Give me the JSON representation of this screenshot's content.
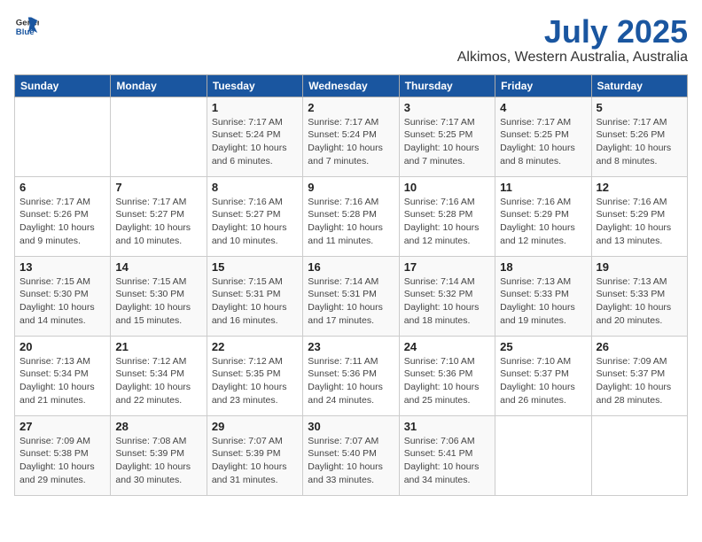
{
  "header": {
    "logo_general": "General",
    "logo_blue": "Blue",
    "title": "July 2025",
    "subtitle": "Alkimos, Western Australia, Australia"
  },
  "weekdays": [
    "Sunday",
    "Monday",
    "Tuesday",
    "Wednesday",
    "Thursday",
    "Friday",
    "Saturday"
  ],
  "weeks": [
    [
      {
        "day": "",
        "detail": ""
      },
      {
        "day": "",
        "detail": ""
      },
      {
        "day": "1",
        "detail": "Sunrise: 7:17 AM\nSunset: 5:24 PM\nDaylight: 10 hours\nand 6 minutes."
      },
      {
        "day": "2",
        "detail": "Sunrise: 7:17 AM\nSunset: 5:24 PM\nDaylight: 10 hours\nand 7 minutes."
      },
      {
        "day": "3",
        "detail": "Sunrise: 7:17 AM\nSunset: 5:25 PM\nDaylight: 10 hours\nand 7 minutes."
      },
      {
        "day": "4",
        "detail": "Sunrise: 7:17 AM\nSunset: 5:25 PM\nDaylight: 10 hours\nand 8 minutes."
      },
      {
        "day": "5",
        "detail": "Sunrise: 7:17 AM\nSunset: 5:26 PM\nDaylight: 10 hours\nand 8 minutes."
      }
    ],
    [
      {
        "day": "6",
        "detail": "Sunrise: 7:17 AM\nSunset: 5:26 PM\nDaylight: 10 hours\nand 9 minutes."
      },
      {
        "day": "7",
        "detail": "Sunrise: 7:17 AM\nSunset: 5:27 PM\nDaylight: 10 hours\nand 10 minutes."
      },
      {
        "day": "8",
        "detail": "Sunrise: 7:16 AM\nSunset: 5:27 PM\nDaylight: 10 hours\nand 10 minutes."
      },
      {
        "day": "9",
        "detail": "Sunrise: 7:16 AM\nSunset: 5:28 PM\nDaylight: 10 hours\nand 11 minutes."
      },
      {
        "day": "10",
        "detail": "Sunrise: 7:16 AM\nSunset: 5:28 PM\nDaylight: 10 hours\nand 12 minutes."
      },
      {
        "day": "11",
        "detail": "Sunrise: 7:16 AM\nSunset: 5:29 PM\nDaylight: 10 hours\nand 12 minutes."
      },
      {
        "day": "12",
        "detail": "Sunrise: 7:16 AM\nSunset: 5:29 PM\nDaylight: 10 hours\nand 13 minutes."
      }
    ],
    [
      {
        "day": "13",
        "detail": "Sunrise: 7:15 AM\nSunset: 5:30 PM\nDaylight: 10 hours\nand 14 minutes."
      },
      {
        "day": "14",
        "detail": "Sunrise: 7:15 AM\nSunset: 5:30 PM\nDaylight: 10 hours\nand 15 minutes."
      },
      {
        "day": "15",
        "detail": "Sunrise: 7:15 AM\nSunset: 5:31 PM\nDaylight: 10 hours\nand 16 minutes."
      },
      {
        "day": "16",
        "detail": "Sunrise: 7:14 AM\nSunset: 5:31 PM\nDaylight: 10 hours\nand 17 minutes."
      },
      {
        "day": "17",
        "detail": "Sunrise: 7:14 AM\nSunset: 5:32 PM\nDaylight: 10 hours\nand 18 minutes."
      },
      {
        "day": "18",
        "detail": "Sunrise: 7:13 AM\nSunset: 5:33 PM\nDaylight: 10 hours\nand 19 minutes."
      },
      {
        "day": "19",
        "detail": "Sunrise: 7:13 AM\nSunset: 5:33 PM\nDaylight: 10 hours\nand 20 minutes."
      }
    ],
    [
      {
        "day": "20",
        "detail": "Sunrise: 7:13 AM\nSunset: 5:34 PM\nDaylight: 10 hours\nand 21 minutes."
      },
      {
        "day": "21",
        "detail": "Sunrise: 7:12 AM\nSunset: 5:34 PM\nDaylight: 10 hours\nand 22 minutes."
      },
      {
        "day": "22",
        "detail": "Sunrise: 7:12 AM\nSunset: 5:35 PM\nDaylight: 10 hours\nand 23 minutes."
      },
      {
        "day": "23",
        "detail": "Sunrise: 7:11 AM\nSunset: 5:36 PM\nDaylight: 10 hours\nand 24 minutes."
      },
      {
        "day": "24",
        "detail": "Sunrise: 7:10 AM\nSunset: 5:36 PM\nDaylight: 10 hours\nand 25 minutes."
      },
      {
        "day": "25",
        "detail": "Sunrise: 7:10 AM\nSunset: 5:37 PM\nDaylight: 10 hours\nand 26 minutes."
      },
      {
        "day": "26",
        "detail": "Sunrise: 7:09 AM\nSunset: 5:37 PM\nDaylight: 10 hours\nand 28 minutes."
      }
    ],
    [
      {
        "day": "27",
        "detail": "Sunrise: 7:09 AM\nSunset: 5:38 PM\nDaylight: 10 hours\nand 29 minutes."
      },
      {
        "day": "28",
        "detail": "Sunrise: 7:08 AM\nSunset: 5:39 PM\nDaylight: 10 hours\nand 30 minutes."
      },
      {
        "day": "29",
        "detail": "Sunrise: 7:07 AM\nSunset: 5:39 PM\nDaylight: 10 hours\nand 31 minutes."
      },
      {
        "day": "30",
        "detail": "Sunrise: 7:07 AM\nSunset: 5:40 PM\nDaylight: 10 hours\nand 33 minutes."
      },
      {
        "day": "31",
        "detail": "Sunrise: 7:06 AM\nSunset: 5:41 PM\nDaylight: 10 hours\nand 34 minutes."
      },
      {
        "day": "",
        "detail": ""
      },
      {
        "day": "",
        "detail": ""
      }
    ]
  ]
}
